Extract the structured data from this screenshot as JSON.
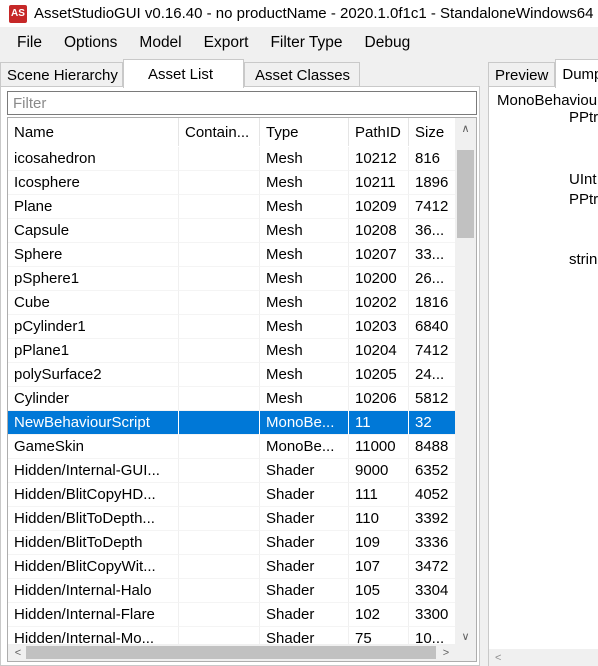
{
  "window": {
    "title": "AssetStudioGUI v0.16.40 - no productName - 2020.1.0f1c1 - StandaloneWindows64",
    "icon_text": "AS"
  },
  "menu": [
    "File",
    "Options",
    "Model",
    "Export",
    "Filter Type",
    "Debug"
  ],
  "left_tabs": [
    "Scene Hierarchy",
    "Asset List",
    "Asset Classes"
  ],
  "active_left_tab": "Asset List",
  "filter": {
    "placeholder": "Filter",
    "value": ""
  },
  "columns": [
    "Name",
    "Contain...",
    "Type",
    "PathID",
    "Size"
  ],
  "rows": [
    [
      "icosahedron",
      "",
      "Mesh",
      "10212",
      "816"
    ],
    [
      "Icosphere",
      "",
      "Mesh",
      "10211",
      "1896"
    ],
    [
      "Plane",
      "",
      "Mesh",
      "10209",
      "7412"
    ],
    [
      "Capsule",
      "",
      "Mesh",
      "10208",
      "36..."
    ],
    [
      "Sphere",
      "",
      "Mesh",
      "10207",
      "33..."
    ],
    [
      "pSphere1",
      "",
      "Mesh",
      "10200",
      "26..."
    ],
    [
      "Cube",
      "",
      "Mesh",
      "10202",
      "1816"
    ],
    [
      "pCylinder1",
      "",
      "Mesh",
      "10203",
      "6840"
    ],
    [
      "pPlane1",
      "",
      "Mesh",
      "10204",
      "7412"
    ],
    [
      "polySurface2",
      "",
      "Mesh",
      "10205",
      "24..."
    ],
    [
      "Cylinder",
      "",
      "Mesh",
      "10206",
      "5812"
    ],
    [
      "NewBehaviourScript",
      "",
      "MonoBe...",
      "11",
      "32"
    ],
    [
      "GameSkin",
      "",
      "MonoBe...",
      "11000",
      "8488"
    ],
    [
      "Hidden/Internal-GUI...",
      "",
      "Shader",
      "9000",
      "6352"
    ],
    [
      "Hidden/BlitCopyHD...",
      "",
      "Shader",
      "111",
      "4052"
    ],
    [
      "Hidden/BlitToDepth...",
      "",
      "Shader",
      "110",
      "3392"
    ],
    [
      "Hidden/BlitToDepth",
      "",
      "Shader",
      "109",
      "3336"
    ],
    [
      "Hidden/BlitCopyWit...",
      "",
      "Shader",
      "107",
      "3472"
    ],
    [
      "Hidden/Internal-Halo",
      "",
      "Shader",
      "105",
      "3304"
    ],
    [
      "Hidden/Internal-Flare",
      "",
      "Shader",
      "102",
      "3300"
    ],
    [
      "Hidden/Internal-Mo...",
      "",
      "Shader",
      "75",
      "10..."
    ]
  ],
  "selected_row_name": "NewBehaviourScript",
  "right_tabs": [
    "Preview",
    "Dump"
  ],
  "active_right_tab": "Dump",
  "dump_lines": [
    "MonoBehaviour",
    "PPtr",
    "UInt",
    "PPtr",
    "string"
  ],
  "scroll_glyphs": {
    "up": "∧",
    "down": "∨",
    "left": "<",
    "right": ">"
  }
}
